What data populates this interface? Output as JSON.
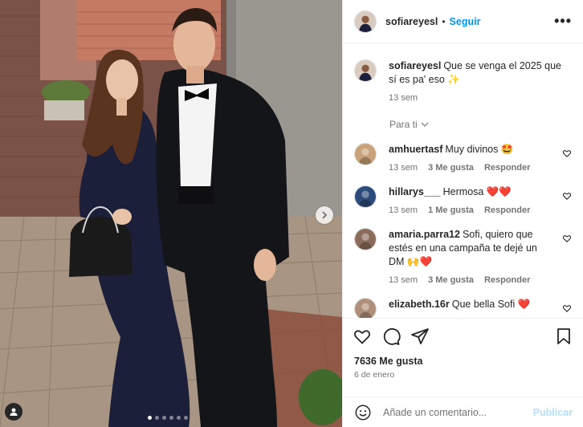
{
  "post": {
    "username": "sofiareyesl",
    "separator": "•",
    "follow_label": "Seguir",
    "more_label": "•••",
    "caption_text": "Que se venga el 2025 que sí es pa' eso ✨",
    "caption_time": "13 sem",
    "sort_label": "Para ti",
    "carousel_dots": 6,
    "carousel_active_index": 0
  },
  "comments": [
    {
      "username": "amhuertasf",
      "text": "Muy divinos 🤩",
      "time": "13 sem",
      "likes": "3 Me gusta",
      "reply": "Responder",
      "avatar_color": "#c9a27a"
    },
    {
      "username": "hillarys___",
      "text": "Hermosa ❤️❤️",
      "time": "13 sem",
      "likes": "1 Me gusta",
      "reply": "Responder",
      "avatar_color": "#2c4a7a"
    },
    {
      "username": "amaria.parra12",
      "text": "Sofi, quiero que estés en una campaña te dejé un DM 🙌❤️",
      "time": "13 sem",
      "likes": "3 Me gusta",
      "reply": "Responder",
      "avatar_color": "#8b6b5a"
    },
    {
      "username": "elizabeth.16r",
      "text": "Que bella Sofi ❤️",
      "time": "",
      "likes": "",
      "reply": "",
      "avatar_color": "#b08f7a"
    }
  ],
  "actions": {
    "like_icon": "heart-icon",
    "comment_icon": "comment-icon",
    "share_icon": "share-icon",
    "save_icon": "bookmark-icon"
  },
  "likes_count": "7636 Me gusta",
  "post_date": "6 de enero",
  "add_comment": {
    "placeholder": "Añade un comentario...",
    "publish_label": "Publicar"
  },
  "colors": {
    "accent": "#0095f6",
    "publish_disabled": "#b2dffc",
    "secondary_text": "#737373",
    "heart_red": "#ed4956"
  }
}
